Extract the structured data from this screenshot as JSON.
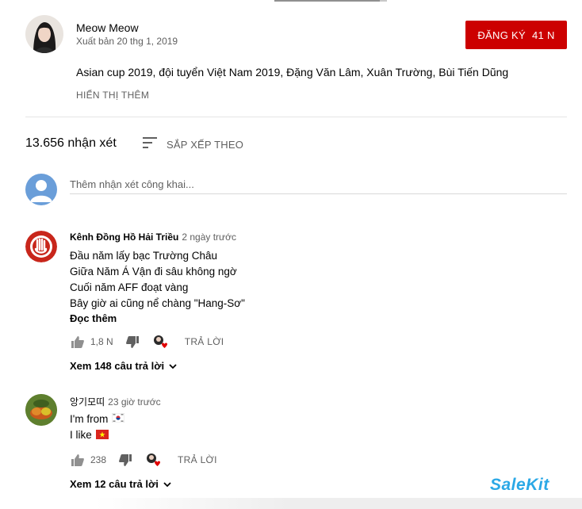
{
  "video_progress": {
    "fraction": 0.94
  },
  "owner": {
    "name": "Meow Meow",
    "published": "Xuất bản 20 thg 1, 2019",
    "subscribe_label": "ĐĂNG KÝ",
    "subscriber_count": "41 N"
  },
  "description": {
    "text": "Asian cup 2019, đội tuyển Việt Nam 2019, Đặng Văn Lâm, Xuân Trường, Bùi Tiến Dũng",
    "show_more": "HIỂN THỊ THÊM"
  },
  "comments_header": {
    "count": "13.656 nhận xét",
    "sort_label": "SẮP XẾP THEO"
  },
  "new_comment": {
    "placeholder": "Thêm nhận xét công khai..."
  },
  "comments": [
    {
      "author": "Kênh Đồng Hồ Hải Triều",
      "time": "2 ngày trước",
      "lines": [
        "Đầu năm lấy bạc Trường Châu",
        "Giữa Năm Á Vận đi sâu không ngờ",
        "Cuối năm AFF đoạt vàng",
        "Bây giờ ai cũng nể chàng \"Hang-Sơ\""
      ],
      "read_more": "Đọc thêm",
      "likes": "1,8 N",
      "reply_label": "TRẢ LỜI",
      "replies_label": "Xem 148 câu trả lời"
    },
    {
      "author": "앙기모띠",
      "time": "23 giờ trước",
      "lines": [
        "I'm from",
        "I like"
      ],
      "likes": "238",
      "reply_label": "TRẢ LỜI",
      "replies_label": "Xem 12 câu trả lời"
    }
  ],
  "watermark": "SaleKit",
  "colors": {
    "subscribe": "#cc0000",
    "secondary_text": "#606060",
    "heart": "#e00000",
    "watermark": "#2aa8e6"
  },
  "icons": [
    "thumb-up-icon",
    "thumb-down-icon",
    "creator-heart-icon",
    "sort-icon",
    "chevron-down-icon",
    "korea-flag-icon",
    "vietnam-flag-icon"
  ]
}
